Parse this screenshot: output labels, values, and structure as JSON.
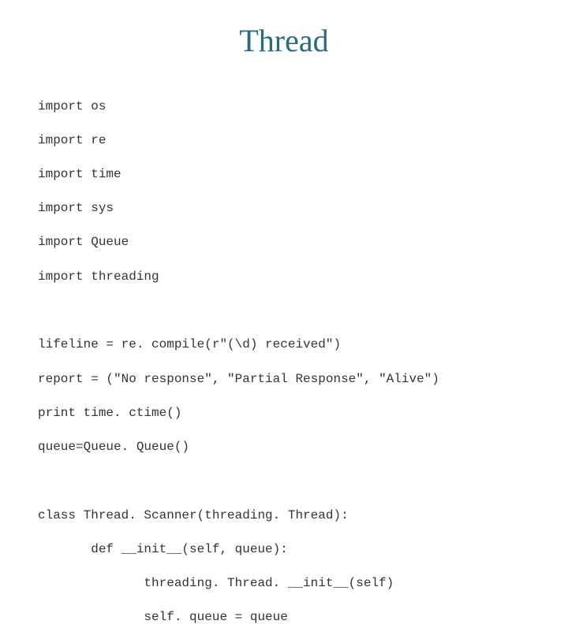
{
  "title": "Thread",
  "imports": [
    "import os",
    "import re",
    "import time",
    "import sys",
    "import Queue",
    "import threading"
  ],
  "setup": [
    "lifeline = re. compile(r\"(\\d) received\")",
    "report = (\"No response\", \"Partial Response\", \"Alive\")",
    "print time. ctime()",
    "queue=Queue. Queue()"
  ],
  "classdef": [
    "class Thread. Scanner(threading. Thread):",
    "       def __init__(self, queue):",
    "              threading. Thread. __init__(self)",
    "              self. queue = queue"
  ]
}
